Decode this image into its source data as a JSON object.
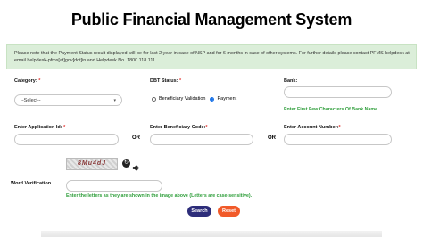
{
  "title": "Public Financial Management System",
  "notice": "Please note that the Payment Status result displayed will be for last 2 year in case of NSP and for 6 months in case of other systems. For further details please contact PFMS helpdesk at email helpdesk-pfms[at]gov[dot]in and Helpdesk No. 1800 118 111.",
  "category": {
    "label": "Category:",
    "req": "*",
    "selected": "--Select--"
  },
  "dbt_status": {
    "label": "DBT Status:",
    "req": "*",
    "options": [
      "Beneficiary Validation",
      "Payment"
    ],
    "selected": "Payment"
  },
  "bank": {
    "label": "Bank:",
    "value": "",
    "hint": "Enter First Few Characters Of Bank Name"
  },
  "application_id": {
    "label": "Enter Application Id:",
    "req": "*",
    "value": ""
  },
  "beneficiary_code": {
    "label": "Enter Beneficiary Code:",
    "req": "*",
    "value": ""
  },
  "account_number": {
    "label": "Enter Account Number:",
    "req": "*",
    "value": ""
  },
  "or_label": "OR",
  "word_verification": {
    "label": "Word Verification",
    "captcha_text": "8Mu4dJ",
    "value": "",
    "hint": "Enter the letters as they are shown in the image above (Letters are case-sensitive)."
  },
  "buttons": {
    "search": "Search",
    "reset": "Reset"
  },
  "colors": {
    "notice_bg": "#dbeed9",
    "search_btn": "#2d2d7a",
    "reset_btn": "#f15a29",
    "hint": "#2e9e3a"
  }
}
